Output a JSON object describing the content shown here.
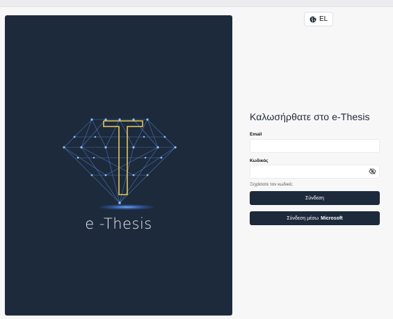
{
  "language": {
    "code": "EL",
    "icon": "globe-icon"
  },
  "hero": {
    "brand": "e -Thesis"
  },
  "login": {
    "title": "Καλωσήρθατε στο e-Thesis",
    "email_label": "Email",
    "email_value": "",
    "password_label": "Κωδικός",
    "password_value": "",
    "forgot_link": "Ξεχάσατε τον κωδικό;",
    "submit_label": "Σύνδεση",
    "microsoft_prefix": "Σύνδεση μέσω",
    "microsoft_brand": "Microsoft"
  },
  "colors": {
    "navy": "#1d2a3b",
    "gold": "#e8c85a",
    "node": "#6fa8ff"
  }
}
